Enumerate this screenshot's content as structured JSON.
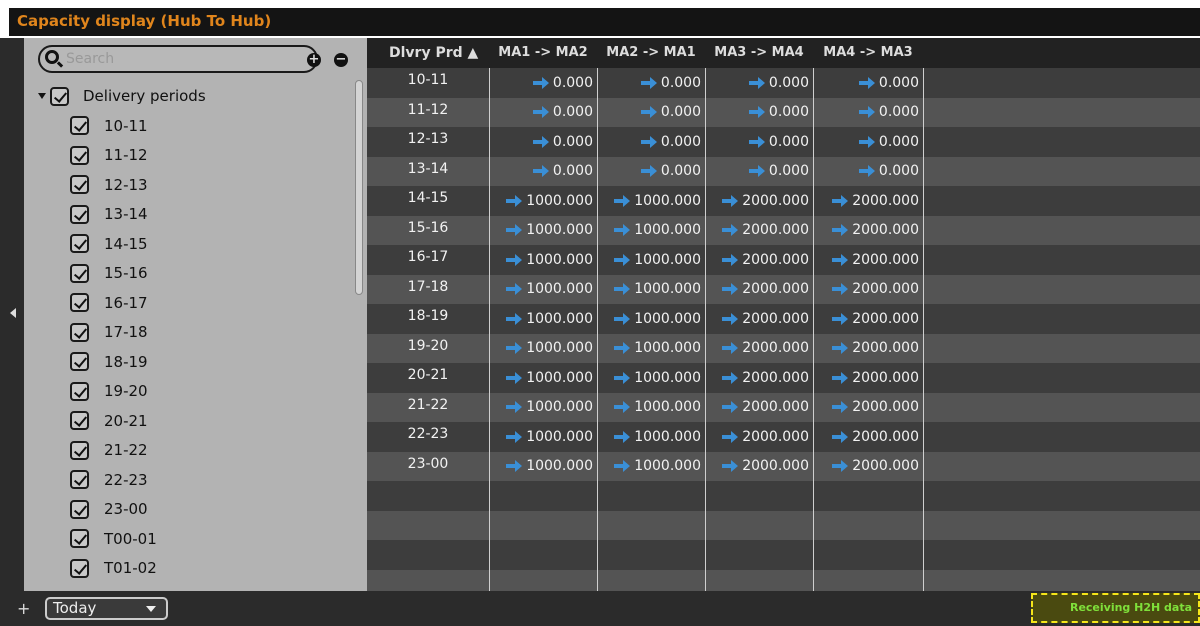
{
  "window": {
    "title": "Capacity display (Hub To Hub)"
  },
  "sidebar": {
    "search_placeholder": "Search",
    "root_label": "Delivery periods",
    "items": [
      "10-11",
      "11-12",
      "12-13",
      "13-14",
      "14-15",
      "15-16",
      "16-17",
      "17-18",
      "18-19",
      "19-20",
      "20-21",
      "21-22",
      "22-23",
      "23-00",
      "T00-01",
      "T01-02"
    ]
  },
  "grid": {
    "columns": [
      "Dlvry Prd ▲",
      "MA1 -> MA2",
      "MA2 -> MA1",
      "MA3 -> MA4",
      "MA4 -> MA3"
    ],
    "rows": [
      {
        "prd": "10-11",
        "v": [
          "0.000",
          "0.000",
          "0.000",
          "0.000"
        ]
      },
      {
        "prd": "11-12",
        "v": [
          "0.000",
          "0.000",
          "0.000",
          "0.000"
        ]
      },
      {
        "prd": "12-13",
        "v": [
          "0.000",
          "0.000",
          "0.000",
          "0.000"
        ]
      },
      {
        "prd": "13-14",
        "v": [
          "0.000",
          "0.000",
          "0.000",
          "0.000"
        ]
      },
      {
        "prd": "14-15",
        "v": [
          "1000.000",
          "1000.000",
          "2000.000",
          "2000.000"
        ]
      },
      {
        "prd": "15-16",
        "v": [
          "1000.000",
          "1000.000",
          "2000.000",
          "2000.000"
        ]
      },
      {
        "prd": "16-17",
        "v": [
          "1000.000",
          "1000.000",
          "2000.000",
          "2000.000"
        ]
      },
      {
        "prd": "17-18",
        "v": [
          "1000.000",
          "1000.000",
          "2000.000",
          "2000.000"
        ]
      },
      {
        "prd": "18-19",
        "v": [
          "1000.000",
          "1000.000",
          "2000.000",
          "2000.000"
        ]
      },
      {
        "prd": "19-20",
        "v": [
          "1000.000",
          "1000.000",
          "2000.000",
          "2000.000"
        ]
      },
      {
        "prd": "20-21",
        "v": [
          "1000.000",
          "1000.000",
          "2000.000",
          "2000.000"
        ]
      },
      {
        "prd": "21-22",
        "v": [
          "1000.000",
          "1000.000",
          "2000.000",
          "2000.000"
        ]
      },
      {
        "prd": "22-23",
        "v": [
          "1000.000",
          "1000.000",
          "2000.000",
          "2000.000"
        ]
      },
      {
        "prd": "23-00",
        "v": [
          "1000.000",
          "1000.000",
          "2000.000",
          "2000.000"
        ]
      }
    ],
    "empty_rows": 4,
    "arrow_color": "#3a8fd6"
  },
  "footer": {
    "plus": "+",
    "date_select": "Today",
    "status": "Receiving H2H data"
  },
  "colors": {
    "title": "#e0851c",
    "status_text": "#7fe03a",
    "status_border": "#f5e61a"
  }
}
